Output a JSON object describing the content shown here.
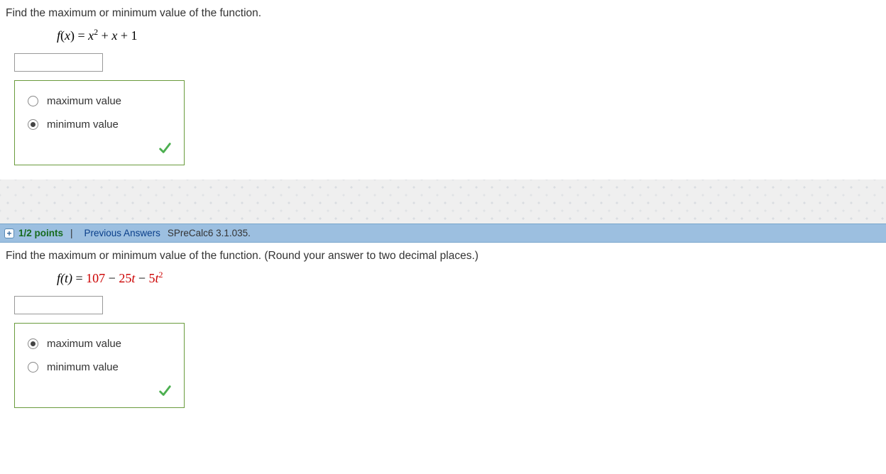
{
  "question1": {
    "prompt": "Find the maximum or minimum value of the function.",
    "formula_parts": {
      "lhs": "f(x) = ",
      "rhs_html": "x² + x + 1"
    },
    "choices": {
      "maximum": "maximum value",
      "minimum": "minimum value"
    },
    "selected": "minimum",
    "correct": true
  },
  "header": {
    "expand_symbol": "+",
    "points": "1/2 points",
    "separator": "|",
    "previous": "Previous Answers",
    "ref": "SPreCalc6 3.1.035."
  },
  "question2": {
    "prompt": "Find the maximum or minimum value of the function. (Round your answer to two decimal places.)",
    "formula_parts": {
      "lhs": "f(t)",
      "eq": " = ",
      "const": "107",
      "minus": " − ",
      "coef1": "25",
      "var1": "t",
      "coef2": "5",
      "var2": "t",
      "exp": "2"
    },
    "choices": {
      "maximum": "maximum value",
      "minimum": "minimum value"
    },
    "selected": "maximum",
    "correct": true
  }
}
